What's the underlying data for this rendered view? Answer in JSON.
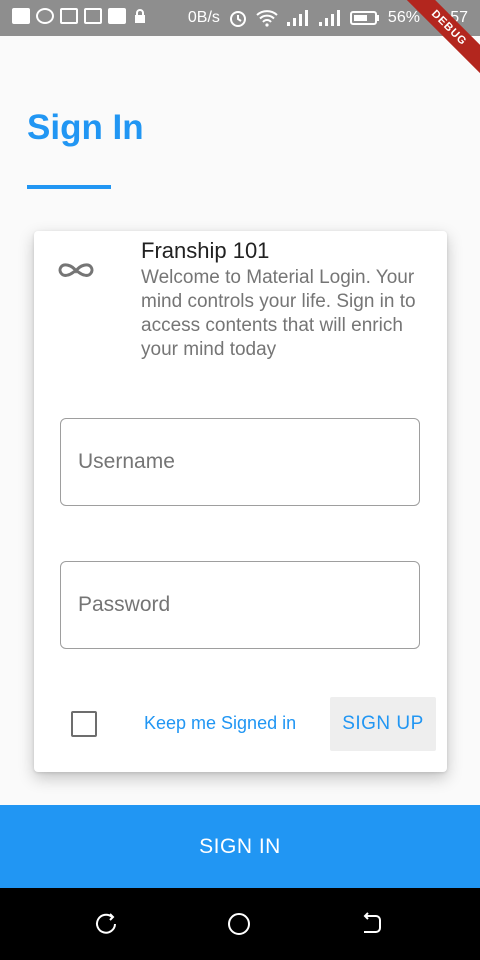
{
  "status_bar": {
    "speed": "0B/s",
    "battery": "56%",
    "time": "16:57"
  },
  "debug_banner": "DEBUG",
  "page": {
    "title": "Sign In",
    "accent_color": "#2196f3"
  },
  "card": {
    "title": "Franship 101",
    "subtitle": "Welcome to Material Login. Your mind controls your life. Sign in to access contents that will enrich your mind today",
    "icon": "infinity-icon"
  },
  "form": {
    "username_placeholder": "Username",
    "username_value": "",
    "password_placeholder": "Password",
    "password_value": "",
    "keep_signed_in_label": "Keep me Signed in",
    "keep_signed_in_checked": false,
    "signup_label": "SIGN UP"
  },
  "signin_label": "SIGN IN",
  "nav": {
    "icons": [
      "recent-apps-icon",
      "home-icon",
      "back-icon"
    ]
  }
}
